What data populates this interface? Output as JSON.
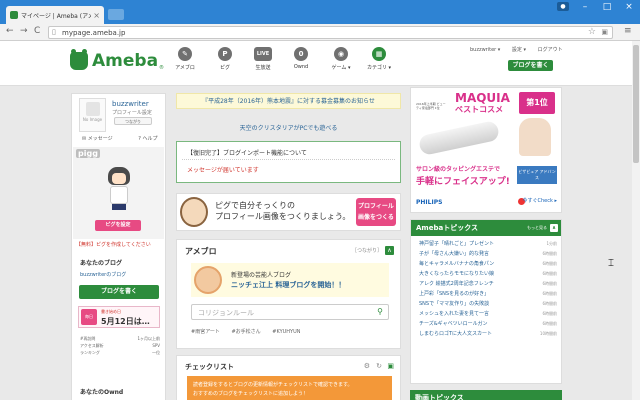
{
  "browser": {
    "tab_title": "マイページ | Ameba (アメーバ)",
    "tab_close": "×",
    "url": "mypage.ameba.jp",
    "win_min": "–",
    "win_max": "□",
    "win_close": "×",
    "back": "←",
    "forward": "→",
    "reload": "C",
    "star": "☆",
    "menu": "≡"
  },
  "header": {
    "logo": "Ameba",
    "logo_mark": "®",
    "nav": [
      {
        "icon": "✎",
        "label": "アメブロ"
      },
      {
        "icon": "P",
        "label": "ピグ"
      },
      {
        "icon": "LIVE",
        "label": "生放送"
      },
      {
        "icon": "0",
        "label": "Ownd"
      },
      {
        "icon": "◉",
        "label": "ゲーム ▾"
      },
      {
        "icon": "▦",
        "label": "カテゴリ ▾"
      }
    ],
    "user_link": "buzzwriter ▾",
    "settings_link": "設定 ▾",
    "logout_link": "ログアウト",
    "write_button": "ブログを書く"
  },
  "left": {
    "username": "buzzwriter",
    "profile_sub": "プロフィール設定",
    "follow_button": "つながり",
    "no_image": "No Image",
    "message_link": "メッセージ",
    "help_link": "ヘルプ",
    "pigg_logo": "pigg",
    "pigg_button": "ピグを設定",
    "pigg_note": "【無料】ピグを作成してください",
    "your_blog_title": "あなたのブログ",
    "your_blog_link": "buzzwriterのブログ",
    "write_button": "ブログを書く",
    "days_badge": "毎日",
    "days_label": "書き始め日",
    "days_date": "5月12日は…",
    "stats": [
      {
        "label": "#再訪問",
        "value": "1ヶ月以上前"
      },
      {
        "label": "アクセス解析",
        "value": "SPV"
      },
      {
        "label": "ランキング",
        "value": "一位"
      }
    ],
    "ownd_title": "あなたのOwnd"
  },
  "middle": {
    "notice": "『平成28年（2016年）熊本地震』に対する募金募集のお知らせ",
    "notice_link": "天空のクリスタリアがPCでも遊べる",
    "news_title": "【復旧完了】ブログインポート機能について",
    "news_message": "メッセージが届いています",
    "promo_line1": "ピグで自分そっくりの",
    "promo_line2": "プロフィール画像をつくりましょう。",
    "promo_button_l1": "プロフィール",
    "promo_button_l2": "画像をつくる",
    "ameba_title": "アメブロ",
    "ameba_connect": "［つながり］",
    "collapse": "∧",
    "featured_line1": "新登場の芸能人ブログ",
    "featured_line2": "ニッチェ江上 料理ブログを開始！！",
    "search_placeholder": "コリジョンルール",
    "search_icon": "⚲",
    "tags": [
      "#雨宮アート",
      "#お手松さん",
      "#KYUHYUN"
    ],
    "checklist_title": "チェックリスト",
    "checklist_banner_1": "読者登録をするとブログの更新情報がチェックリストで確認できます。",
    "checklist_banner_2": "おすすめのブログをチェックリストに追加しよう！"
  },
  "right": {
    "ad": {
      "brand": "MAQUIA",
      "headline": "ベストコスメ",
      "rank": "第1位",
      "award": "2016年上半期 ビューティ家電部門 1位",
      "catch1": "サロン級のタッピングエステで",
      "catch2": "手軽にフェイスアップ!",
      "side": "ビザビュア アドバンス",
      "maker": "PHILIPS",
      "cta": "今すぐCheck ▸"
    },
    "topics_title": "Amebaトピックス",
    "topics_more": "もっと見る",
    "topics": [
      {
        "text": "神戸留子「晴れごと」プレゼント",
        "time": "1分前"
      },
      {
        "text": "子が「母さん大嫌い」的な発言",
        "time": "6時間前"
      },
      {
        "text": "毎とキャラメルバナナの角食パン",
        "time": "6時間前"
      },
      {
        "text": "大きくなったらモモになりたい娘",
        "time": "6時間前"
      },
      {
        "text": "アレク 絵描式2周年記念フレンチ",
        "time": "6時間前"
      },
      {
        "text": "上戸彩「SNSを見るのが好き」",
        "time": "6時間前"
      },
      {
        "text": "SNSで「ママ友作り」の失敗談",
        "time": "6時間前"
      },
      {
        "text": "メッシュを入れた妻を見て一言",
        "time": "6時間前"
      },
      {
        "text": "チーズ&ギャベツいロールガン",
        "time": "6時間前"
      },
      {
        "text": "しまむらロゴTに大人文スカート",
        "time": "10時間前"
      }
    ],
    "video_title": "動画トピックス"
  }
}
